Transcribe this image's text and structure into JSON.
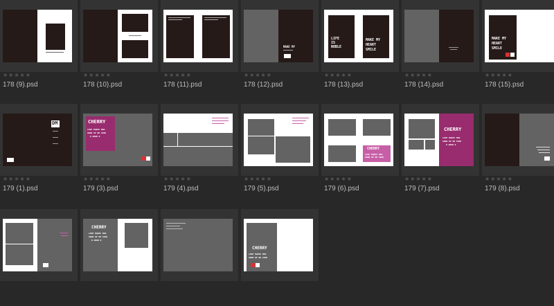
{
  "files": [
    {
      "name": "178 (9).psd",
      "rating": "★★★★★"
    },
    {
      "name": "178 (10).psd",
      "rating": "★★★★★"
    },
    {
      "name": "178 (11).psd",
      "rating": "★★★★★"
    },
    {
      "name": "178 (12).psd",
      "rating": "★★★★★"
    },
    {
      "name": "178 (13).psd",
      "rating": "★★★★★"
    },
    {
      "name": "178 (14).psd",
      "rating": "★★★★★"
    },
    {
      "name": "178 (15).psd",
      "rating": "★★★★★"
    },
    {
      "name": "179 (1).psd",
      "rating": "★★★★★"
    },
    {
      "name": "179 (3).psd",
      "rating": "★★★★★"
    },
    {
      "name": "179 (4).psd",
      "rating": "★★★★★"
    },
    {
      "name": "179 (5).psd",
      "rating": "★★★★★"
    },
    {
      "name": "179 (6).psd",
      "rating": "★★★★★"
    },
    {
      "name": "179 (7).psd",
      "rating": "★★★★★"
    },
    {
      "name": "179 (8).psd",
      "rating": "★★★★★"
    },
    {
      "name": "",
      "rating": ""
    },
    {
      "name": "",
      "rating": ""
    },
    {
      "name": "",
      "rating": ""
    },
    {
      "name": "",
      "rating": ""
    }
  ],
  "thumb_text": {
    "make_my_heart_smile": "MAKE MY HEART SMILE",
    "make_my": "MAKE MY",
    "heart": "HEART",
    "smile": "SMILE",
    "life": "LIFE",
    "is": "IS",
    "noble": "NOBLE",
    "dm": "DM",
    "cherry": "CHERRY",
    "love1": "LOVE MAKES MAN",
    "love2": "GROW UP OR SINK",
    "love3": "D UOWN D"
  },
  "colors": {
    "background": "#282828",
    "panel": "#333333",
    "dark_brown": "#261a19",
    "gray_page": "#636363",
    "magenta": "#982c6e",
    "pink": "#c75fa6",
    "label_text": "#bdbdbd"
  }
}
